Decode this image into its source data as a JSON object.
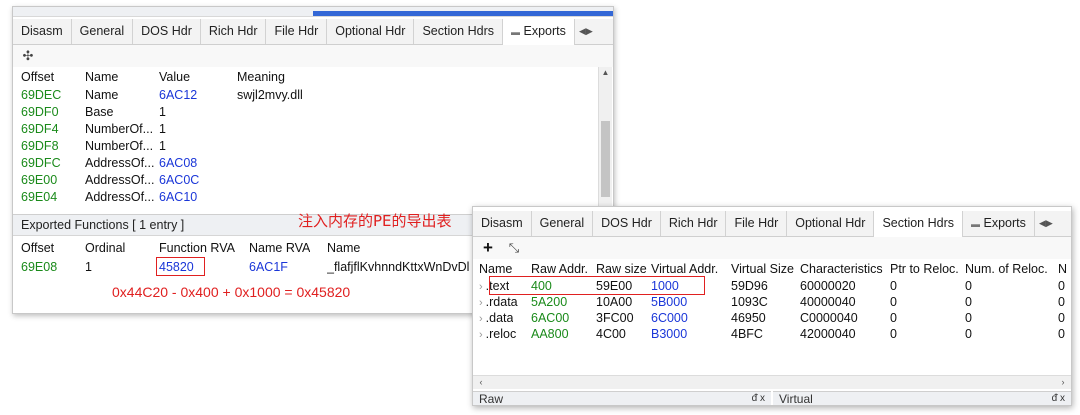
{
  "window1": {
    "tabs": [
      {
        "label": "Disasm"
      },
      {
        "label": "General"
      },
      {
        "label": "DOS Hdr"
      },
      {
        "label": "Rich Hdr"
      },
      {
        "label": "File Hdr"
      },
      {
        "label": "Optional Hdr"
      },
      {
        "label": "Section Hdrs"
      },
      {
        "label": "Exports",
        "icon": "table-icon"
      }
    ],
    "toolbar": {
      "icon": "move-icon",
      "glyph": "✣"
    },
    "table": {
      "columns": [
        "Offset",
        "Name",
        "Value",
        "Meaning"
      ],
      "rows": [
        {
          "offset": "69DEC",
          "name": "Name",
          "value": "6AC12",
          "meaning": "swjl2mvy.dll"
        },
        {
          "offset": "69DF0",
          "name": "Base",
          "value": "1",
          "meaning": ""
        },
        {
          "offset": "69DF4",
          "name": "NumberOf...",
          "value": "1",
          "meaning": ""
        },
        {
          "offset": "69DF8",
          "name": "NumberOf...",
          "value": "1",
          "meaning": ""
        },
        {
          "offset": "69DFC",
          "name": "AddressOf...",
          "value": "6AC08",
          "meaning": ""
        },
        {
          "offset": "69E00",
          "name": "AddressOf...",
          "value": "6AC0C",
          "meaning": ""
        },
        {
          "offset": "69E04",
          "name": "AddressOf...",
          "value": "6AC10",
          "meaning": ""
        }
      ]
    },
    "exports_section": {
      "label": "Exported Functions   [ 1 entry ]",
      "columns": [
        "Offset",
        "Ordinal",
        "Function RVA",
        "Name RVA",
        "Name"
      ],
      "rows": [
        {
          "offset": "69E08",
          "ordinal": "1",
          "function_rva": "45820",
          "name_rva": "6AC1F",
          "name": "_flafjflKvhnndKttxWnDvDl"
        }
      ]
    },
    "annotation_title": "注入内存的PE的导出表",
    "annotation_formula": "0x44C20 - 0x400 + 0x1000 = 0x45820"
  },
  "window2": {
    "tabs": [
      {
        "label": "Disasm"
      },
      {
        "label": "General"
      },
      {
        "label": "DOS Hdr"
      },
      {
        "label": "Rich Hdr"
      },
      {
        "label": "File Hdr"
      },
      {
        "label": "Optional Hdr"
      },
      {
        "label": "Section Hdrs"
      },
      {
        "label": "Exports",
        "icon": "table-icon"
      }
    ],
    "toolbar": {
      "add_glyph": "+",
      "expand_glyph": "⤡"
    },
    "table": {
      "columns": [
        "Name",
        "Raw Addr.",
        "Raw size",
        "Virtual Addr.",
        "Virtual Size",
        "Characteristics",
        "Ptr to Reloc.",
        "Num. of Reloc.",
        "N"
      ],
      "rows": [
        {
          "name": ".text",
          "raw_addr": "400",
          "raw_size": "59E00",
          "virtual_addr": "1000",
          "virtual_size": "59D96",
          "characteristics": "60000020",
          "ptr_reloc": "0",
          "num_reloc": "0",
          "n": "0"
        },
        {
          "name": ".rdata",
          "raw_addr": "5A200",
          "raw_size": "10A00",
          "virtual_addr": "5B000",
          "virtual_size": "1093C",
          "characteristics": "40000040",
          "ptr_reloc": "0",
          "num_reloc": "0",
          "n": "0"
        },
        {
          "name": ".data",
          "raw_addr": "6AC00",
          "raw_size": "3FC00",
          "virtual_addr": "6C000",
          "virtual_size": "46950",
          "characteristics": "C0000040",
          "ptr_reloc": "0",
          "num_reloc": "0",
          "n": "0"
        },
        {
          "name": ".reloc",
          "raw_addr": "AA800",
          "raw_size": "4C00",
          "virtual_addr": "B3000",
          "virtual_size": "4BFC",
          "characteristics": "42000040",
          "ptr_reloc": "0",
          "num_reloc": "0",
          "n": "0"
        }
      ]
    },
    "bottom_panes": [
      {
        "label": "Raw",
        "controls": "ᵭ x"
      },
      {
        "label": "Virtual",
        "controls": "ᵭ x"
      }
    ]
  }
}
